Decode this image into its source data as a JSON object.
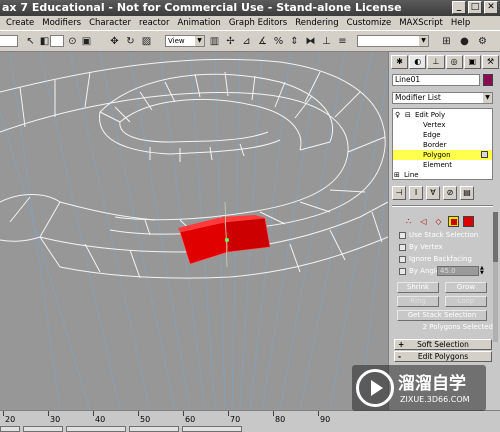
{
  "window": {
    "title": "ax 7  Educational - Not for Commercial Use - Stand-alone License",
    "controls": [
      "_",
      "□",
      "✕"
    ]
  },
  "menu": [
    "Create",
    "Modifiers",
    "Character",
    "reactor",
    "Animation",
    "Graph Editors",
    "Rendering",
    "Customize",
    "MAXScript",
    "Help"
  ],
  "toolbar": {
    "view_select": "View"
  },
  "panel": {
    "object_name": "Line01",
    "object_color": "#8c0a52",
    "modifier_list": "Modifier List",
    "stack": {
      "edit_poly": "Edit Poly",
      "vertex": "Vertex",
      "edge": "Edge",
      "border": "Border",
      "polygon": "Polygon",
      "element": "Element",
      "line": "Line"
    },
    "selection": {
      "use_stack_selection": "Use Stack Selection",
      "by_vertex": "By Vertex",
      "ignore_backfacing": "Ignore Backfacing",
      "by_angle": "By Angle",
      "angle_value": "45.0",
      "shrink": "Shrink",
      "grow": "Grow",
      "ring": "Ring",
      "loop": "Loop",
      "get_stack_selection": "Get Stack Selection",
      "status": "2 Polygons Selected"
    },
    "rollouts": {
      "soft_selection": "Soft Selection",
      "edit_polygons": "Edit Polygons",
      "soft_sign": "+",
      "edit_sign": "-"
    }
  },
  "ruler": {
    "labels": [
      "20",
      "30",
      "40",
      "50",
      "60",
      "70",
      "80",
      "90"
    ]
  },
  "watermark": {
    "text": "溜溜自学",
    "sub": "ZIXUE.3D66.COM"
  }
}
